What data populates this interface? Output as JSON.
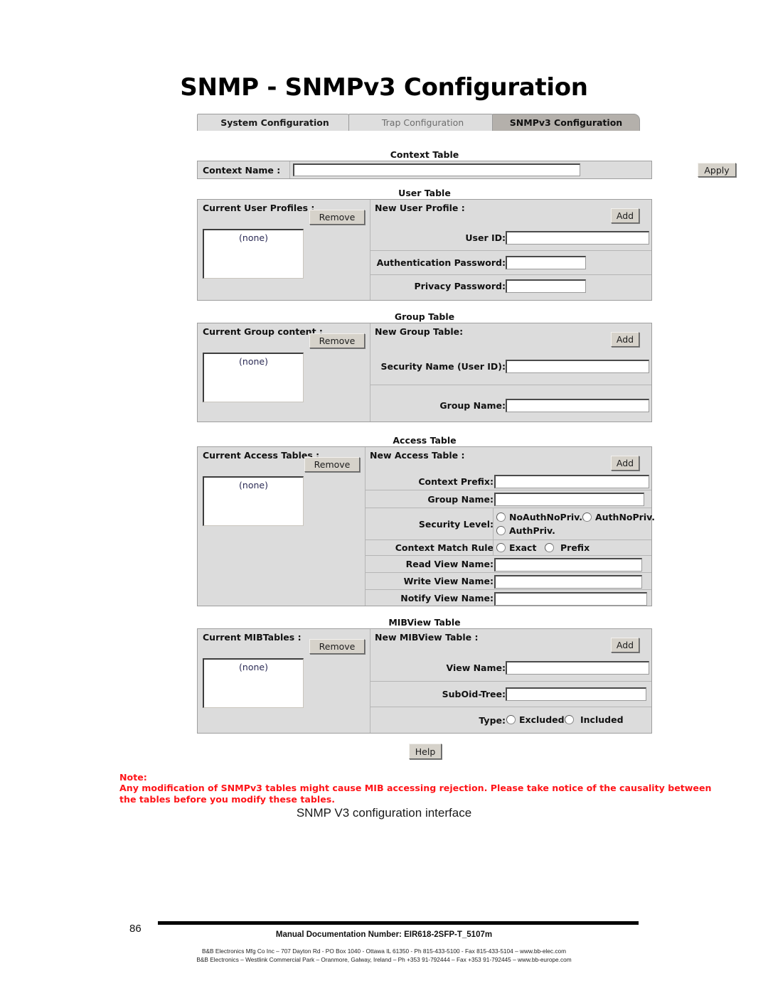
{
  "page": {
    "title": "SNMP - SNMPv3 Configuration",
    "figure_caption": "SNMP V3 configuration interface",
    "page_number": "86",
    "doc_number": "Manual Documentation Number: EIR618-2SFP-T_5107m",
    "footer_line1": "B&B Electronics Mfg Co Inc – 707 Dayton Rd - PO Box 1040 - Ottawa IL 61350 - Ph 815-433-5100 - Fax 815-433-5104 – www.bb-elec.com",
    "footer_line2": "B&B Electronics – Westlink Commercial Park – Oranmore, Galway, Ireland – Ph +353 91-792444 – Fax +353 91-792445 – www.bb-europe.com"
  },
  "tabs": [
    {
      "label": "System Configuration",
      "state": "light"
    },
    {
      "label": "Trap Configuration",
      "state": "muted"
    },
    {
      "label": "SNMPv3 Configuration",
      "state": "active"
    }
  ],
  "context_table": {
    "caption": "Context Table",
    "label": "Context Name :",
    "value": "",
    "apply_label": "Apply"
  },
  "user_table": {
    "caption": "User Table",
    "current_label": "Current User Profiles :",
    "new_label": "New User Profile :",
    "remove_label": "Remove",
    "add_label": "Add",
    "list_value": "(none)",
    "fields": [
      {
        "label": "User ID:",
        "value": ""
      },
      {
        "label": "Authentication Password:",
        "value": ""
      },
      {
        "label": "Privacy Password:",
        "value": ""
      }
    ]
  },
  "group_table": {
    "caption": "Group Table",
    "current_label": "Current Group content :",
    "new_label": "New Group Table:",
    "remove_label": "Remove",
    "add_label": "Add",
    "list_value": "(none)",
    "fields": [
      {
        "label": "Security Name (User ID):",
        "value": ""
      },
      {
        "label": "Group Name:",
        "value": ""
      }
    ]
  },
  "access_table": {
    "caption": "Access Table",
    "current_label": "Current Access Tables :",
    "new_label": "New Access Table :",
    "remove_label": "Remove",
    "add_label": "Add",
    "list_value": "(none)",
    "context_prefix_label": "Context Prefix:",
    "context_prefix_value": "",
    "group_name_label": "Group Name:",
    "group_name_value": "",
    "security_level_label": "Security Level:",
    "security_level_options": [
      "NoAuthNoPriv.",
      "AuthNoPriv.",
      "AuthPriv."
    ],
    "security_level_selected": "",
    "context_match_label": "Context Match Rule",
    "context_match_options": [
      "Exact",
      "Prefix"
    ],
    "context_match_selected": "",
    "read_view_label": "Read View Name:",
    "read_view_value": "",
    "write_view_label": "Write View Name:",
    "write_view_value": "",
    "notify_view_label": "Notify View Name:",
    "notify_view_value": ""
  },
  "mibview_table": {
    "caption": "MIBView Table",
    "current_label": "Current MIBTables :",
    "new_label": "New MIBView Table :",
    "remove_label": "Remove",
    "add_label": "Add",
    "list_value": "(none)",
    "view_name_label": "View Name:",
    "view_name_value": "",
    "suboid_label": "SubOid-Tree:",
    "suboid_value": "",
    "type_label": "Type:",
    "type_options": [
      "Excluded",
      "Included"
    ],
    "type_selected": ""
  },
  "help": {
    "label": "Help"
  },
  "note": {
    "heading": "Note:",
    "body": "Any modification of SNMPv3 tables might cause MIB accessing rejection. Please take notice of the causality between the tables before you modify these tables."
  },
  "colors": {
    "panel_bg": "#dcdcdc",
    "active_tab": "#b4b0ab",
    "note_red": "#ff1418"
  }
}
